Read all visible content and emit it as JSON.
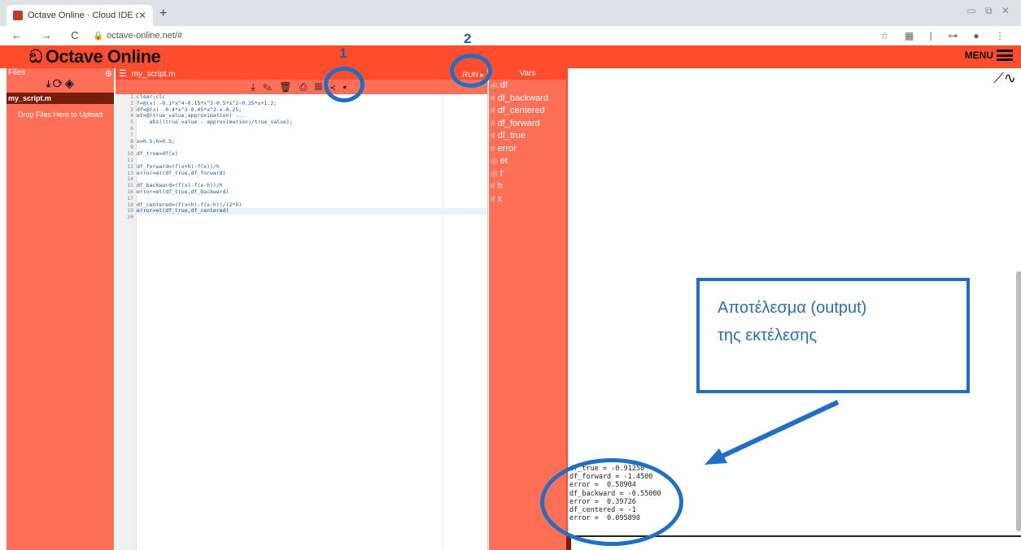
{
  "browser": {
    "tab_title": "Octave Online · Cloud IDE compatib",
    "tab_close": "✕",
    "new_tab": "+",
    "window_controls": "▭ ⧉ ✕",
    "nav": "← → C",
    "url": "octave-online.net/#",
    "addr_icons": "☆ ▦ | ⊶ ● ⋮"
  },
  "app": {
    "logo": "Octave Online",
    "menu_label": "MENU"
  },
  "files": {
    "header": "Files",
    "add_icon": "⊕",
    "tools": "⤓ ⟳ ◈",
    "items": [
      "my_script.m"
    ],
    "drop_text": "Drop Files Here to Upload"
  },
  "editor": {
    "filename": "my_script.m",
    "run_label": "RUN ▸",
    "tools": "⤓ ✎ 🗑 ⎙ ▦ ≺ ▪",
    "lines": [
      "clear;clc",
      "f=@(x) -0.1*x^4-0.15*x^3-0.5*x^2-0.25*x+1.2;",
      "df=@(x) -0.4*x^3-0.45*x^2-x-0.25;",
      "et=@(true_value,approximation) ...",
      "    abs((true_value - approximation)/true_value);",
      "",
      "",
      "x=0.5;h=0.5;",
      "",
      "df_true=df(x)",
      "",
      "df_forward=(f(x+h)-f(x))/h",
      "error=et(df_true,df_forward)",
      "",
      "df_backward=(f(x)-f(x-h))/h",
      "error=et(df_true,df_backward)",
      "",
      "df_centered=(f(x+h)-f(x-h))/(2*h)",
      "error=et(df_true,df_centered)",
      ""
    ],
    "line_numbers": [
      "1",
      "2",
      "3",
      "4",
      "5",
      "6",
      "7",
      "8",
      "9",
      "10",
      "11",
      "12",
      "13",
      "14",
      "15",
      "16",
      "17",
      "18",
      "19",
      "20"
    ]
  },
  "vars": {
    "header": "Vars",
    "items": [
      {
        "sym": "◎",
        "name": "df"
      },
      {
        "sym": "#",
        "name": "df_backward"
      },
      {
        "sym": "#",
        "name": "df_centered"
      },
      {
        "sym": "#",
        "name": "df_forward"
      },
      {
        "sym": "#",
        "name": "df_true"
      },
      {
        "sym": "#",
        "name": "error"
      },
      {
        "sym": "◎",
        "name": "et"
      },
      {
        "sym": "◎",
        "name": "f"
      },
      {
        "sym": "#",
        "name": "h"
      },
      {
        "sym": "#",
        "name": "x"
      }
    ]
  },
  "output": {
    "lines": [
      "df_true = -0.91250",
      "df_forward = -1.4500",
      "error =  0.58904",
      "df_backward = -0.55000",
      "error =  0.39726",
      "df_centered = -1",
      "error =  0.095890"
    ]
  },
  "annotations": {
    "num1": "1",
    "num2": "2",
    "callout_line1": "Αποτέλεσμα (output)",
    "callout_line2": "της εκτέλεσης",
    "accent": "#1f6fc4"
  }
}
